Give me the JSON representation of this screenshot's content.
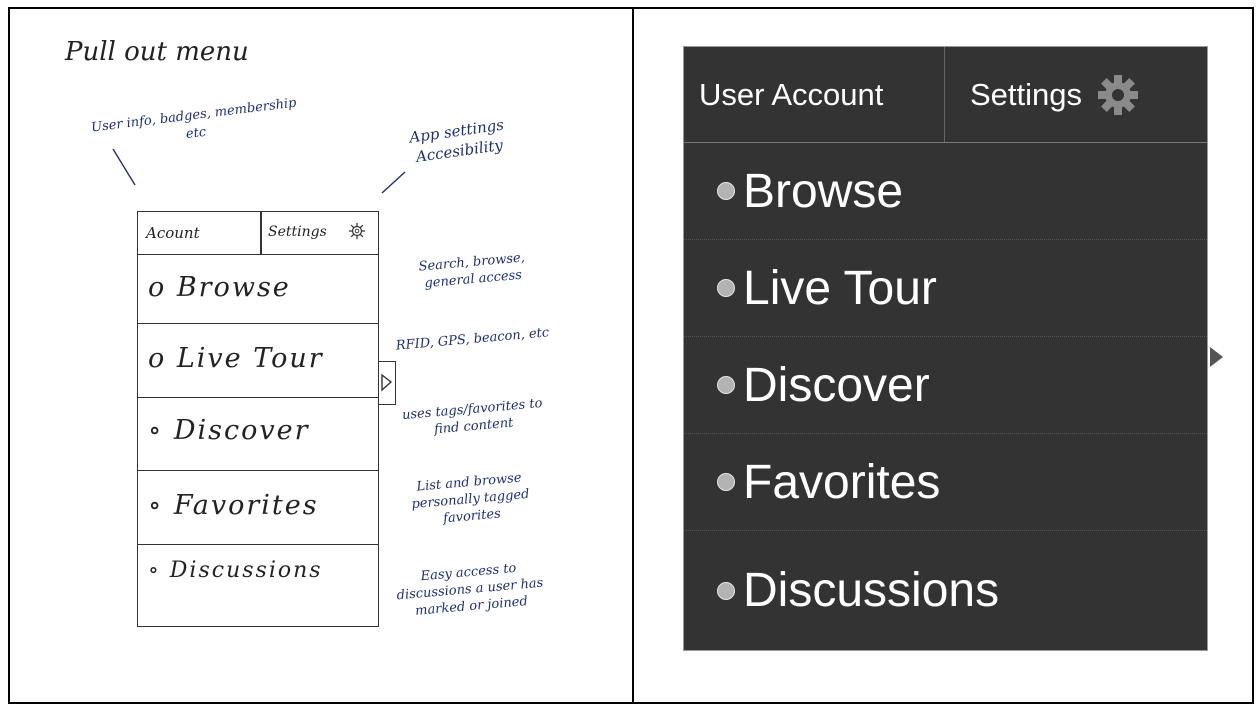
{
  "sketch": {
    "title": "Pull out menu",
    "note_left": "User info, badges, membership etc",
    "note_right": "App settings Accesibility",
    "header": {
      "account": "Acount",
      "settings": "Settings"
    },
    "items": [
      {
        "label": "o Browse",
        "note": "Search, browse, general access"
      },
      {
        "label": "o Live Tour",
        "note": "RFID, GPS, beacon, etc"
      },
      {
        "label": "∘ Discover",
        "note": "uses tags/favorites to find content"
      },
      {
        "label": "∘ Favorites",
        "note": "List and browse personally tagged favorites"
      },
      {
        "label": "∘ Discussions",
        "note": "Easy access to discussions a user has marked or joined"
      }
    ]
  },
  "menu": {
    "header": {
      "account": "User Account",
      "settings": "Settings"
    },
    "items": [
      {
        "label": "Browse"
      },
      {
        "label": "Live Tour"
      },
      {
        "label": "Discover"
      },
      {
        "label": "Favorites"
      },
      {
        "label": "Discussions"
      }
    ],
    "icons": {
      "settings": "gear-icon",
      "bullet": "radio-bullet-icon",
      "expand": "triangle-right-icon"
    },
    "colors": {
      "background": "#333333",
      "text": "#ffffff",
      "bullet": "#b3b3b3"
    }
  }
}
